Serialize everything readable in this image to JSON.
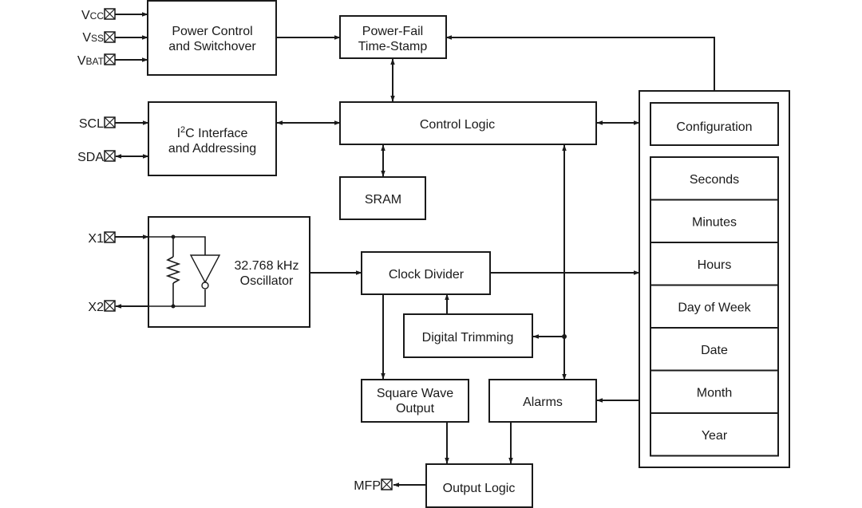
{
  "pins": {
    "vcc": {
      "main": "V",
      "sub": "CC"
    },
    "vss": {
      "main": "V",
      "sub": "SS"
    },
    "vbat": {
      "main": "V",
      "sub": "BAT"
    },
    "scl": "SCL",
    "sda": "SDA",
    "x1": "X1",
    "x2": "X2",
    "mfp": "MFP"
  },
  "blocks": {
    "power_control": [
      "Power Control",
      "and Switchover"
    ],
    "power_fail": [
      "Power-Fail",
      "Time-Stamp"
    ],
    "i2c": {
      "prefix": "I",
      "sup": "2",
      "rest": "C Interface",
      "line2": "and Addressing"
    },
    "control_logic": "Control Logic",
    "sram": "SRAM",
    "oscillator": [
      "32.768 kHz",
      "Oscillator"
    ],
    "clock_divider": "Clock Divider",
    "digital_trimming": "Digital Trimming",
    "square_wave": [
      "Square Wave",
      "Output"
    ],
    "alarms": "Alarms",
    "output_logic": "Output Logic"
  },
  "registers": {
    "configuration": "Configuration",
    "timekeeping": [
      "Seconds",
      "Minutes",
      "Hours",
      "Day of Week",
      "Date",
      "Month",
      "Year"
    ]
  },
  "icons": {
    "pin_marker": "boxed-x-pin-icon",
    "resistor": "resistor-icon",
    "inverter": "inverter-icon"
  }
}
